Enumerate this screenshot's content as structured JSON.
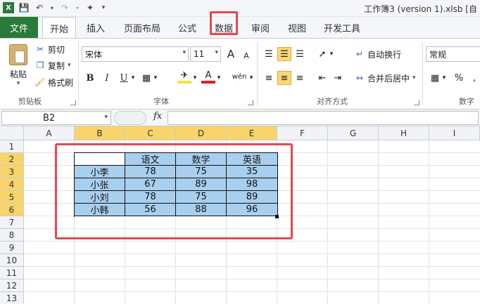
{
  "window": {
    "title": "工作簿3 (version 1).xlsb [自"
  },
  "ribbon_tabs": [
    {
      "label": "文件"
    },
    {
      "label": "开始"
    },
    {
      "label": "插入"
    },
    {
      "label": "页面布局"
    },
    {
      "label": "公式"
    },
    {
      "label": "数据"
    },
    {
      "label": "审阅"
    },
    {
      "label": "视图"
    },
    {
      "label": "开发工具"
    }
  ],
  "clipboard": {
    "paste": "粘贴",
    "cut": "剪切",
    "copy": "复制",
    "format_painter": "格式刷",
    "group": "剪贴板"
  },
  "font": {
    "name": "宋体",
    "size": "11",
    "group": "字体",
    "bold": "B",
    "italic": "I",
    "underline": "U",
    "grow": "A",
    "shrink": "A",
    "font_color": "A",
    "phonetic": "wén"
  },
  "alignment": {
    "wrap": "自动换行",
    "merge": "合并后居中",
    "group": "对齐方式"
  },
  "number": {
    "format": "常规",
    "group": "数字",
    "percent": "%"
  },
  "formula_bar": {
    "name_box": "B2",
    "fx": "fx",
    "formula": ""
  },
  "columns": [
    "A",
    "B",
    "C",
    "D",
    "E",
    "F",
    "G",
    "H",
    "I"
  ],
  "rows": [
    "1",
    "2",
    "3",
    "4",
    "5",
    "6",
    "7",
    "8",
    "9",
    "10",
    "11",
    "12",
    "13"
  ],
  "table": {
    "header": [
      "",
      "语文",
      "数学",
      "英语"
    ],
    "body": [
      [
        "小李",
        "78",
        "75",
        "35"
      ],
      [
        "小张",
        "67",
        "89",
        "98"
      ],
      [
        "小刘",
        "78",
        "75",
        "89"
      ],
      [
        "小韩",
        "56",
        "88",
        "96"
      ]
    ]
  },
  "colors": {
    "file_tab": "#2a7a3b",
    "selection_fill": "#a8cfee",
    "highlight_outline": "#e5484d",
    "header_selected": "#f9d46b"
  }
}
